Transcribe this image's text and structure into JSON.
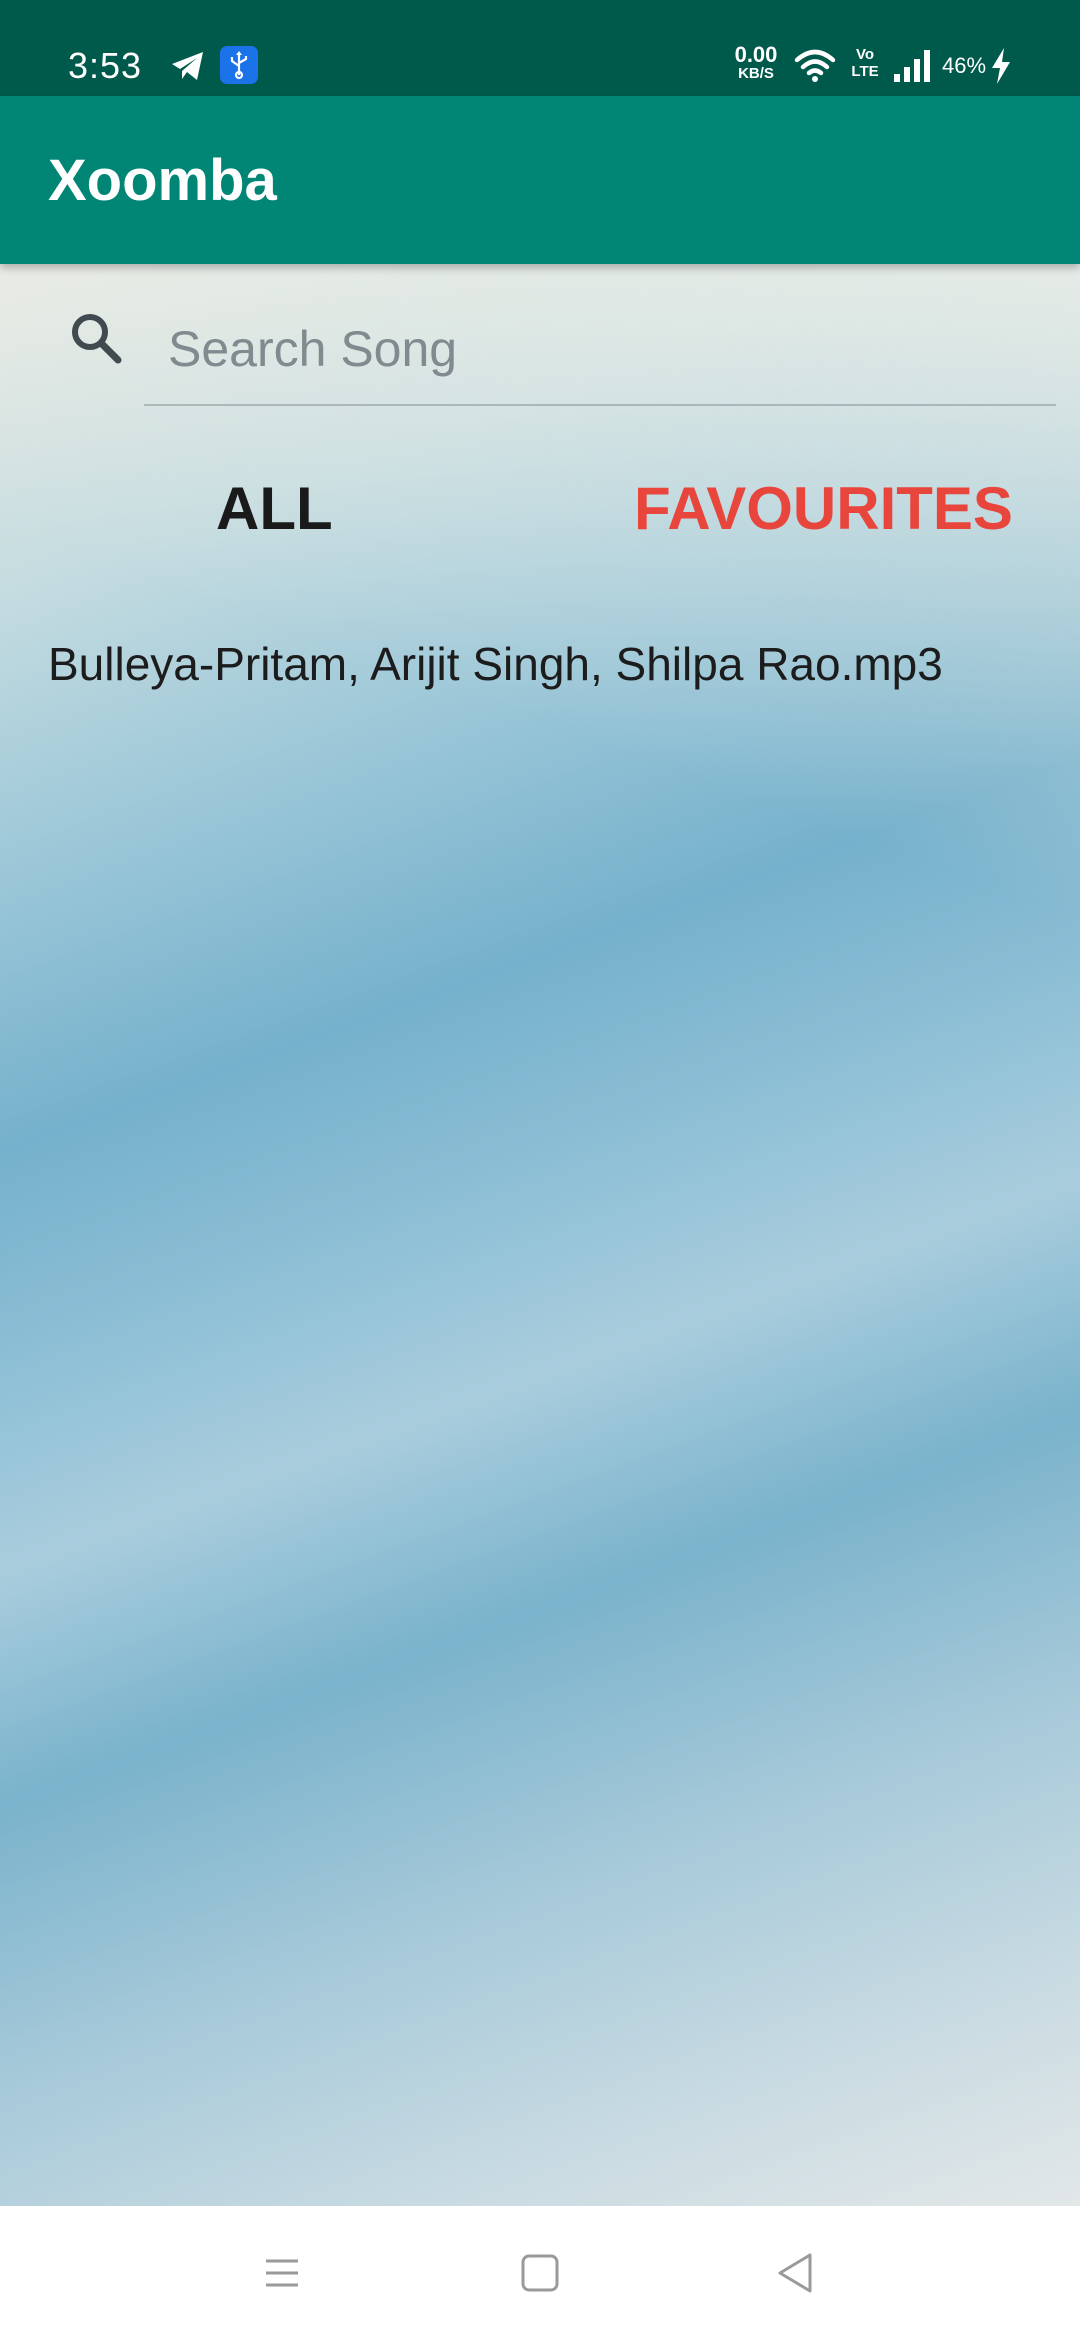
{
  "status_bar": {
    "time": "3:53",
    "net_speed_value": "0.00",
    "net_speed_unit": "KB/S",
    "volte_top": "Vo",
    "volte_bottom": "LTE",
    "battery": "46%",
    "icons": [
      "telegram-icon",
      "usb-icon",
      "wifi-icon",
      "signal-icon",
      "charging-icon"
    ]
  },
  "app_bar": {
    "title": "Xoomba",
    "color": "#018574"
  },
  "search": {
    "placeholder": "Search Song",
    "value": ""
  },
  "tabs": [
    {
      "label": "ALL",
      "color": "#1a1a1a"
    },
    {
      "label": "FAVOURITES",
      "color": "#e8453c"
    }
  ],
  "songs": [
    {
      "title": "Bulleya-Pritam, Arijit Singh, Shilpa Rao.mp3"
    }
  ],
  "nav_bar": {
    "buttons": [
      "menu-icon",
      "home-icon",
      "back-icon"
    ]
  }
}
